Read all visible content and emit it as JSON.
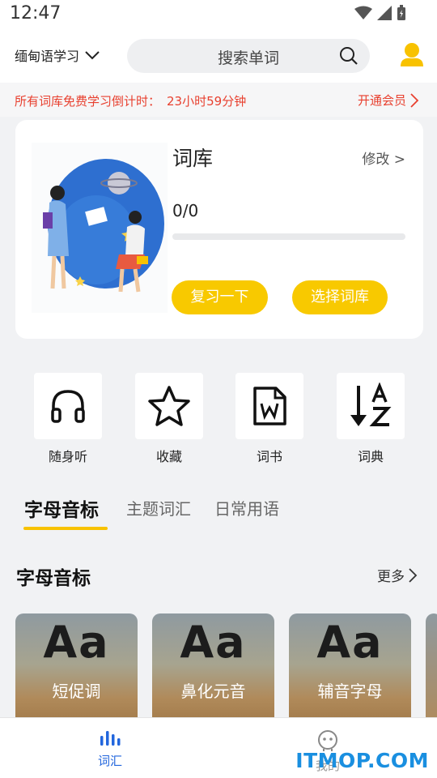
{
  "status_bar": {
    "time": "12:47"
  },
  "header": {
    "language": "缅甸语学习",
    "search_placeholder": "搜索单词"
  },
  "notice": {
    "text": "所有词库免费学习倒计时：",
    "countdown": "23小时59分钟",
    "vip_link": "开通会员"
  },
  "wordbook_card": {
    "title": "词库",
    "edit_label": "修改 >",
    "progress_text": "0/0",
    "progress_fraction": 0,
    "review_button": "复习一下",
    "choose_button": "选择词库"
  },
  "features": [
    {
      "label": "随身听",
      "icon": "headphones-icon"
    },
    {
      "label": "收藏",
      "icon": "star-icon"
    },
    {
      "label": "词书",
      "icon": "word-file-icon"
    },
    {
      "label": "词典",
      "icon": "sort-az-icon"
    }
  ],
  "tabs": [
    {
      "label": "字母音标",
      "active": true
    },
    {
      "label": "主题词汇",
      "active": false
    },
    {
      "label": "日常用语",
      "active": false
    }
  ],
  "section": {
    "title": "字母音标",
    "more_label": "更多"
  },
  "tiles": [
    {
      "big_text": "Aa",
      "label": "短促调"
    },
    {
      "big_text": "Aa",
      "label": "鼻化元音"
    },
    {
      "big_text": "Aa",
      "label": "辅音字母"
    }
  ],
  "bottom_nav": [
    {
      "label": "词汇",
      "active": true,
      "icon": "bar-chart-icon"
    },
    {
      "label": "我的",
      "active": false,
      "icon": "robot-face-icon"
    }
  ],
  "watermark": "ITMOP.COM",
  "colors": {
    "accent_yellow": "#f8c900",
    "notice_red": "#e8402f",
    "nav_active_blue": "#2266dd"
  }
}
